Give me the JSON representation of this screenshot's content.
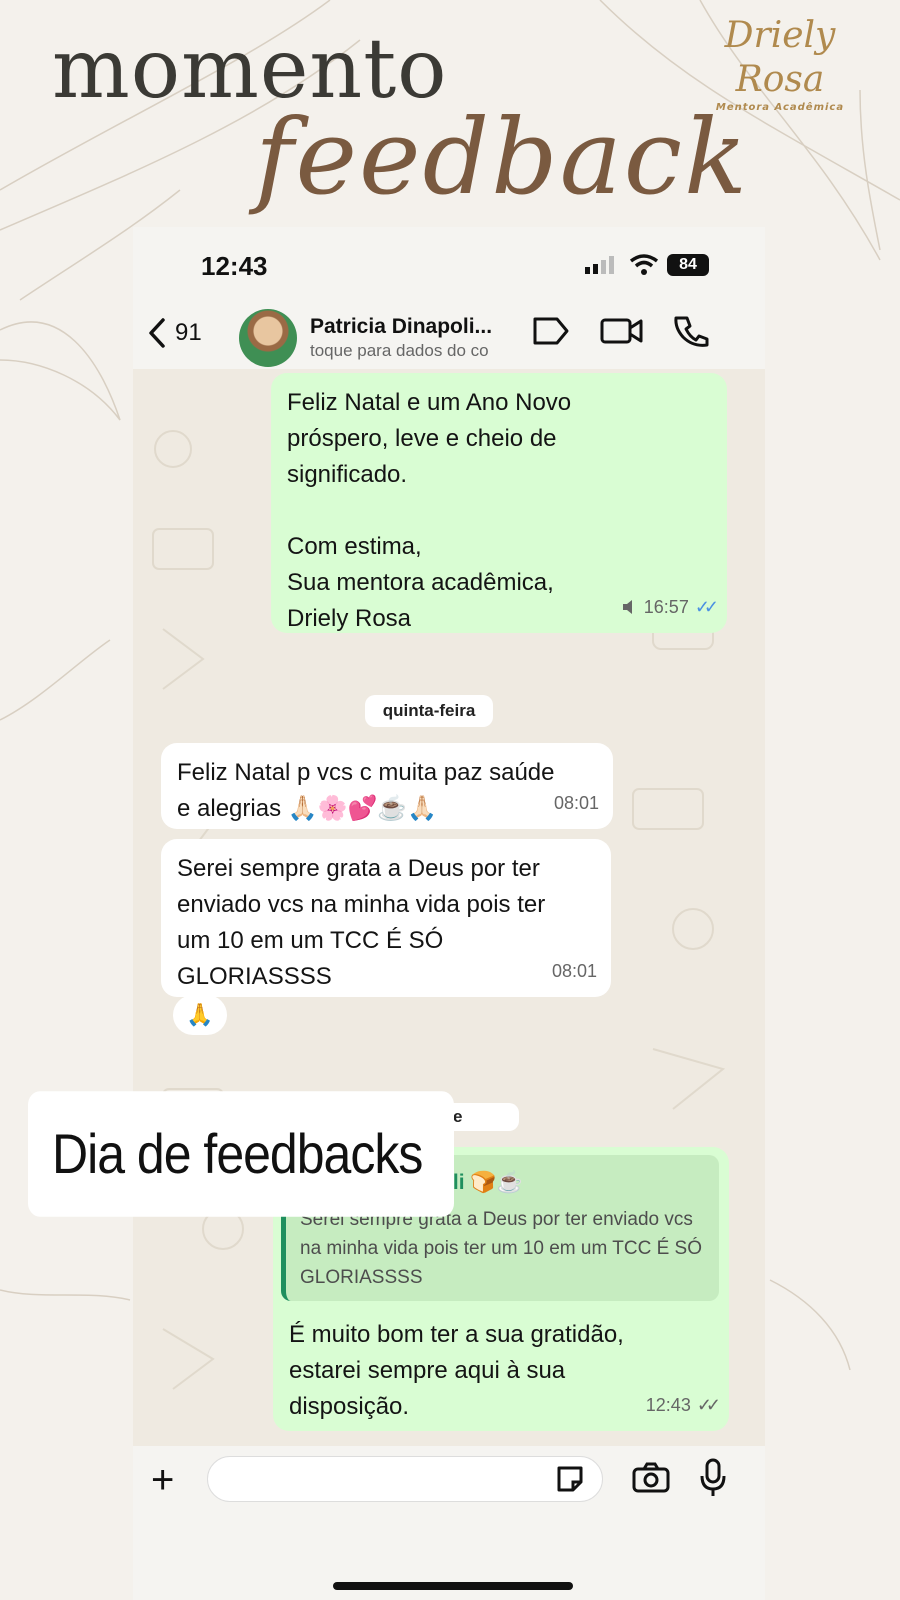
{
  "headline": {
    "line1": "momento",
    "line2": "feedback"
  },
  "brand": {
    "name": "Driely Rosa",
    "subtitle": "Mentora Acadêmica"
  },
  "status_bar": {
    "time": "12:43",
    "battery": "84"
  },
  "chat_header": {
    "back_count": "91",
    "contact_name": "Patricia Dinapoli...",
    "contact_subtitle": "toque para dados do co"
  },
  "messages": [
    {
      "direction": "out",
      "text": "Feliz Natal e um Ano Novo\npróspero, leve e cheio de\nsignificado.\n\nCom estima,\nSua mentora acadêmica,\nDriely Rosa",
      "time": "16:57",
      "read": true
    },
    {
      "direction": "in",
      "text": "Feliz Natal p vcs c muita paz saúde\ne alegrias 🙏🏻🌸💕☕🙏🏻",
      "time": "08:01"
    },
    {
      "direction": "in",
      "text": "Serei sempre grata a Deus por ter\nenviado vcs na minha vida pois ter\num 10 em um TCC É SÓ\nGLORIASSSS",
      "time": "08:01",
      "reaction": "🙏"
    },
    {
      "direction": "out",
      "quote": {
        "author": "Patricia Dinapoli 🍞☕",
        "text": "Serei sempre grata a Deus por ter enviado vcs na minha vida pois ter um 10 em um TCC É SÓ GLORIASSSS"
      },
      "text": "É muito bom ter a sua gratidão,\nestarei sempre aqui à sua\ndisposição.",
      "time": "12:43",
      "read": false
    }
  ],
  "date_separators": [
    "quinta-feira",
    "e"
  ],
  "overlay_label": "Dia de feedbacks",
  "icons": [
    "back-chevron-icon",
    "video-icon",
    "phone-call-icon",
    "tag-icon",
    "plus-icon",
    "sticker-icon",
    "camera-icon",
    "mic-icon",
    "signal-icon",
    "wifi-icon"
  ],
  "colors": {
    "outgoing_bubble": "#d9fdd3",
    "incoming_bubble": "#ffffff",
    "quote_accent": "#1f8f5e",
    "headline_gold": "#7a5a40",
    "brand_gold": "#b08a4e",
    "read_ticks": "#4a90e2"
  }
}
